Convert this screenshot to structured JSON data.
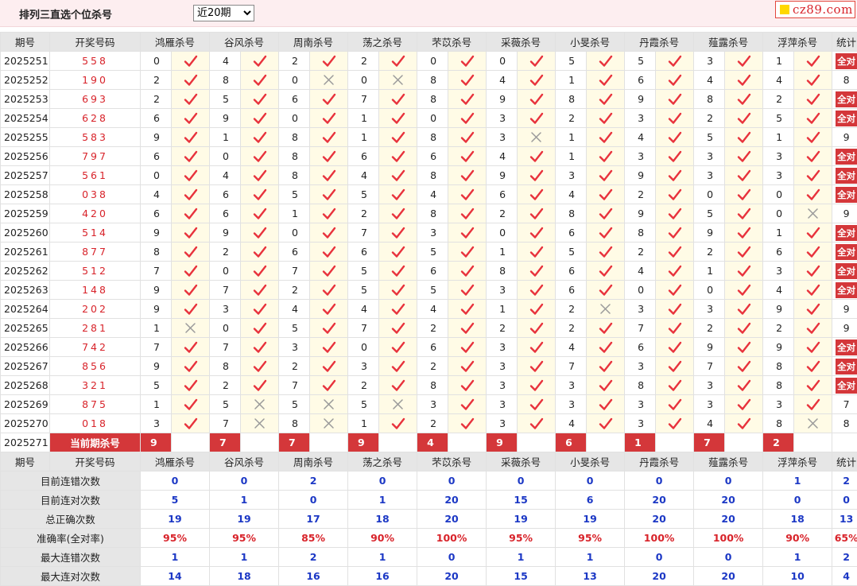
{
  "header": {
    "title": "排列三直选个位杀号",
    "period_selected": "近20期",
    "period_options": [
      "近20期"
    ],
    "logo_text": "cz89.com"
  },
  "columns": {
    "period": "期号",
    "draw": "开奖号码",
    "experts": [
      "鸿雁杀号",
      "谷风杀号",
      "周南杀号",
      "荡之杀号",
      "芣苡杀号",
      "采薇杀号",
      "小旻杀号",
      "丹霞杀号",
      "薤露杀号",
      "浮萍杀号"
    ],
    "stats": "统计"
  },
  "all_correct_label": "全对",
  "rows": [
    {
      "period": "2025251",
      "draw": "558",
      "kills": [
        "0",
        "4",
        "2",
        "2",
        "0",
        "0",
        "5",
        "5",
        "3",
        "1"
      ],
      "marks": [
        1,
        1,
        1,
        1,
        1,
        1,
        1,
        1,
        1,
        1
      ],
      "stat": "全对"
    },
    {
      "period": "2025252",
      "draw": "190",
      "kills": [
        "2",
        "8",
        "0",
        "0",
        "8",
        "4",
        "1",
        "6",
        "4",
        "4"
      ],
      "marks": [
        1,
        1,
        0,
        0,
        1,
        1,
        1,
        1,
        1,
        1
      ],
      "stat": "8"
    },
    {
      "period": "2025253",
      "draw": "693",
      "kills": [
        "2",
        "5",
        "6",
        "7",
        "8",
        "9",
        "8",
        "9",
        "8",
        "2"
      ],
      "marks": [
        1,
        1,
        1,
        1,
        1,
        1,
        1,
        1,
        1,
        1
      ],
      "stat": "全对"
    },
    {
      "period": "2025254",
      "draw": "628",
      "kills": [
        "6",
        "9",
        "0",
        "1",
        "0",
        "3",
        "2",
        "3",
        "2",
        "5"
      ],
      "marks": [
        1,
        1,
        1,
        1,
        1,
        1,
        1,
        1,
        1,
        1
      ],
      "stat": "全对"
    },
    {
      "period": "2025255",
      "draw": "583",
      "kills": [
        "9",
        "1",
        "8",
        "1",
        "8",
        "3",
        "1",
        "4",
        "5",
        "1"
      ],
      "marks": [
        1,
        1,
        1,
        1,
        1,
        0,
        1,
        1,
        1,
        1
      ],
      "stat": "9"
    },
    {
      "period": "2025256",
      "draw": "797",
      "kills": [
        "6",
        "0",
        "8",
        "6",
        "6",
        "4",
        "1",
        "3",
        "3",
        "3"
      ],
      "marks": [
        1,
        1,
        1,
        1,
        1,
        1,
        1,
        1,
        1,
        1
      ],
      "stat": "全对"
    },
    {
      "period": "2025257",
      "draw": "561",
      "kills": [
        "0",
        "4",
        "8",
        "4",
        "8",
        "9",
        "3",
        "9",
        "3",
        "3"
      ],
      "marks": [
        1,
        1,
        1,
        1,
        1,
        1,
        1,
        1,
        1,
        1
      ],
      "stat": "全对"
    },
    {
      "period": "2025258",
      "draw": "038",
      "kills": [
        "4",
        "6",
        "5",
        "5",
        "4",
        "6",
        "4",
        "2",
        "0",
        "0"
      ],
      "marks": [
        1,
        1,
        1,
        1,
        1,
        1,
        1,
        1,
        1,
        1
      ],
      "stat": "全对"
    },
    {
      "period": "2025259",
      "draw": "420",
      "kills": [
        "6",
        "6",
        "1",
        "2",
        "8",
        "2",
        "8",
        "9",
        "5",
        "0"
      ],
      "marks": [
        1,
        1,
        1,
        1,
        1,
        1,
        1,
        1,
        1,
        0
      ],
      "stat": "9"
    },
    {
      "period": "2025260",
      "draw": "514",
      "kills": [
        "9",
        "9",
        "0",
        "7",
        "3",
        "0",
        "6",
        "8",
        "9",
        "1"
      ],
      "marks": [
        1,
        1,
        1,
        1,
        1,
        1,
        1,
        1,
        1,
        1
      ],
      "stat": "全对"
    },
    {
      "period": "2025261",
      "draw": "877",
      "kills": [
        "8",
        "2",
        "6",
        "6",
        "5",
        "1",
        "5",
        "2",
        "2",
        "6"
      ],
      "marks": [
        1,
        1,
        1,
        1,
        1,
        1,
        1,
        1,
        1,
        1
      ],
      "stat": "全对"
    },
    {
      "period": "2025262",
      "draw": "512",
      "kills": [
        "7",
        "0",
        "7",
        "5",
        "6",
        "8",
        "6",
        "4",
        "1",
        "3"
      ],
      "marks": [
        1,
        1,
        1,
        1,
        1,
        1,
        1,
        1,
        1,
        1
      ],
      "stat": "全对"
    },
    {
      "period": "2025263",
      "draw": "148",
      "kills": [
        "9",
        "7",
        "2",
        "5",
        "5",
        "3",
        "6",
        "0",
        "0",
        "4"
      ],
      "marks": [
        1,
        1,
        1,
        1,
        1,
        1,
        1,
        1,
        1,
        1
      ],
      "stat": "全对"
    },
    {
      "period": "2025264",
      "draw": "202",
      "kills": [
        "9",
        "3",
        "4",
        "4",
        "4",
        "1",
        "2",
        "3",
        "3",
        "9"
      ],
      "marks": [
        1,
        1,
        1,
        1,
        1,
        1,
        0,
        1,
        1,
        1
      ],
      "stat": "9"
    },
    {
      "period": "2025265",
      "draw": "281",
      "kills": [
        "1",
        "0",
        "5",
        "7",
        "2",
        "2",
        "2",
        "7",
        "2",
        "2"
      ],
      "marks": [
        0,
        1,
        1,
        1,
        1,
        1,
        1,
        1,
        1,
        1
      ],
      "stat": "9"
    },
    {
      "period": "2025266",
      "draw": "742",
      "kills": [
        "7",
        "7",
        "3",
        "0",
        "6",
        "3",
        "4",
        "6",
        "9",
        "9"
      ],
      "marks": [
        1,
        1,
        1,
        1,
        1,
        1,
        1,
        1,
        1,
        1
      ],
      "stat": "全对"
    },
    {
      "period": "2025267",
      "draw": "856",
      "kills": [
        "9",
        "8",
        "2",
        "3",
        "2",
        "3",
        "7",
        "3",
        "7",
        "8"
      ],
      "marks": [
        1,
        1,
        1,
        1,
        1,
        1,
        1,
        1,
        1,
        1
      ],
      "stat": "全对"
    },
    {
      "period": "2025268",
      "draw": "321",
      "kills": [
        "5",
        "2",
        "7",
        "2",
        "8",
        "3",
        "3",
        "8",
        "3",
        "8"
      ],
      "marks": [
        1,
        1,
        1,
        1,
        1,
        1,
        1,
        1,
        1,
        1
      ],
      "stat": "全对"
    },
    {
      "period": "2025269",
      "draw": "875",
      "kills": [
        "1",
        "5",
        "5",
        "5",
        "3",
        "3",
        "3",
        "3",
        "3",
        "3"
      ],
      "marks": [
        1,
        0,
        0,
        0,
        1,
        1,
        1,
        1,
        1,
        1
      ],
      "stat": "7"
    },
    {
      "period": "2025270",
      "draw": "018",
      "kills": [
        "3",
        "7",
        "8",
        "1",
        "2",
        "3",
        "4",
        "3",
        "4",
        "8"
      ],
      "marks": [
        1,
        0,
        0,
        1,
        1,
        1,
        1,
        1,
        1,
        0
      ],
      "stat": "8"
    }
  ],
  "current": {
    "period": "2025271",
    "label": "当前期杀号",
    "kills": [
      "9",
      "7",
      "7",
      "9",
      "4",
      "9",
      "6",
      "1",
      "7",
      "2"
    ]
  },
  "summary": [
    {
      "label": "目前连错次数",
      "values": [
        "0",
        "0",
        "2",
        "0",
        "0",
        "0",
        "0",
        "0",
        "0",
        "1",
        "2"
      ]
    },
    {
      "label": "目前连对次数",
      "values": [
        "5",
        "1",
        "0",
        "1",
        "20",
        "15",
        "6",
        "20",
        "20",
        "0",
        "0"
      ]
    },
    {
      "label": "总正确次数",
      "values": [
        "19",
        "19",
        "17",
        "18",
        "20",
        "19",
        "19",
        "20",
        "20",
        "18",
        "13"
      ]
    },
    {
      "label": "准确率(全对率)",
      "values": [
        "95%",
        "95%",
        "85%",
        "90%",
        "100%",
        "95%",
        "95%",
        "100%",
        "100%",
        "90%",
        "65%"
      ],
      "is_rate": true
    },
    {
      "label": "最大连错次数",
      "values": [
        "1",
        "1",
        "2",
        "1",
        "0",
        "1",
        "1",
        "0",
        "0",
        "1",
        "2"
      ]
    },
    {
      "label": "最大连对次数",
      "values": [
        "14",
        "18",
        "16",
        "16",
        "20",
        "15",
        "13",
        "20",
        "20",
        "10",
        "4"
      ]
    }
  ],
  "colors": {
    "accent": "#d4373a",
    "blue": "#1c38c5",
    "check": "#e8323c",
    "cross": "#9a9a9a",
    "header_bg": "#e6e6e6",
    "mark_bg": "#fffbe6"
  },
  "icons": {
    "correct": "check-icon",
    "wrong": "cross-icon"
  }
}
